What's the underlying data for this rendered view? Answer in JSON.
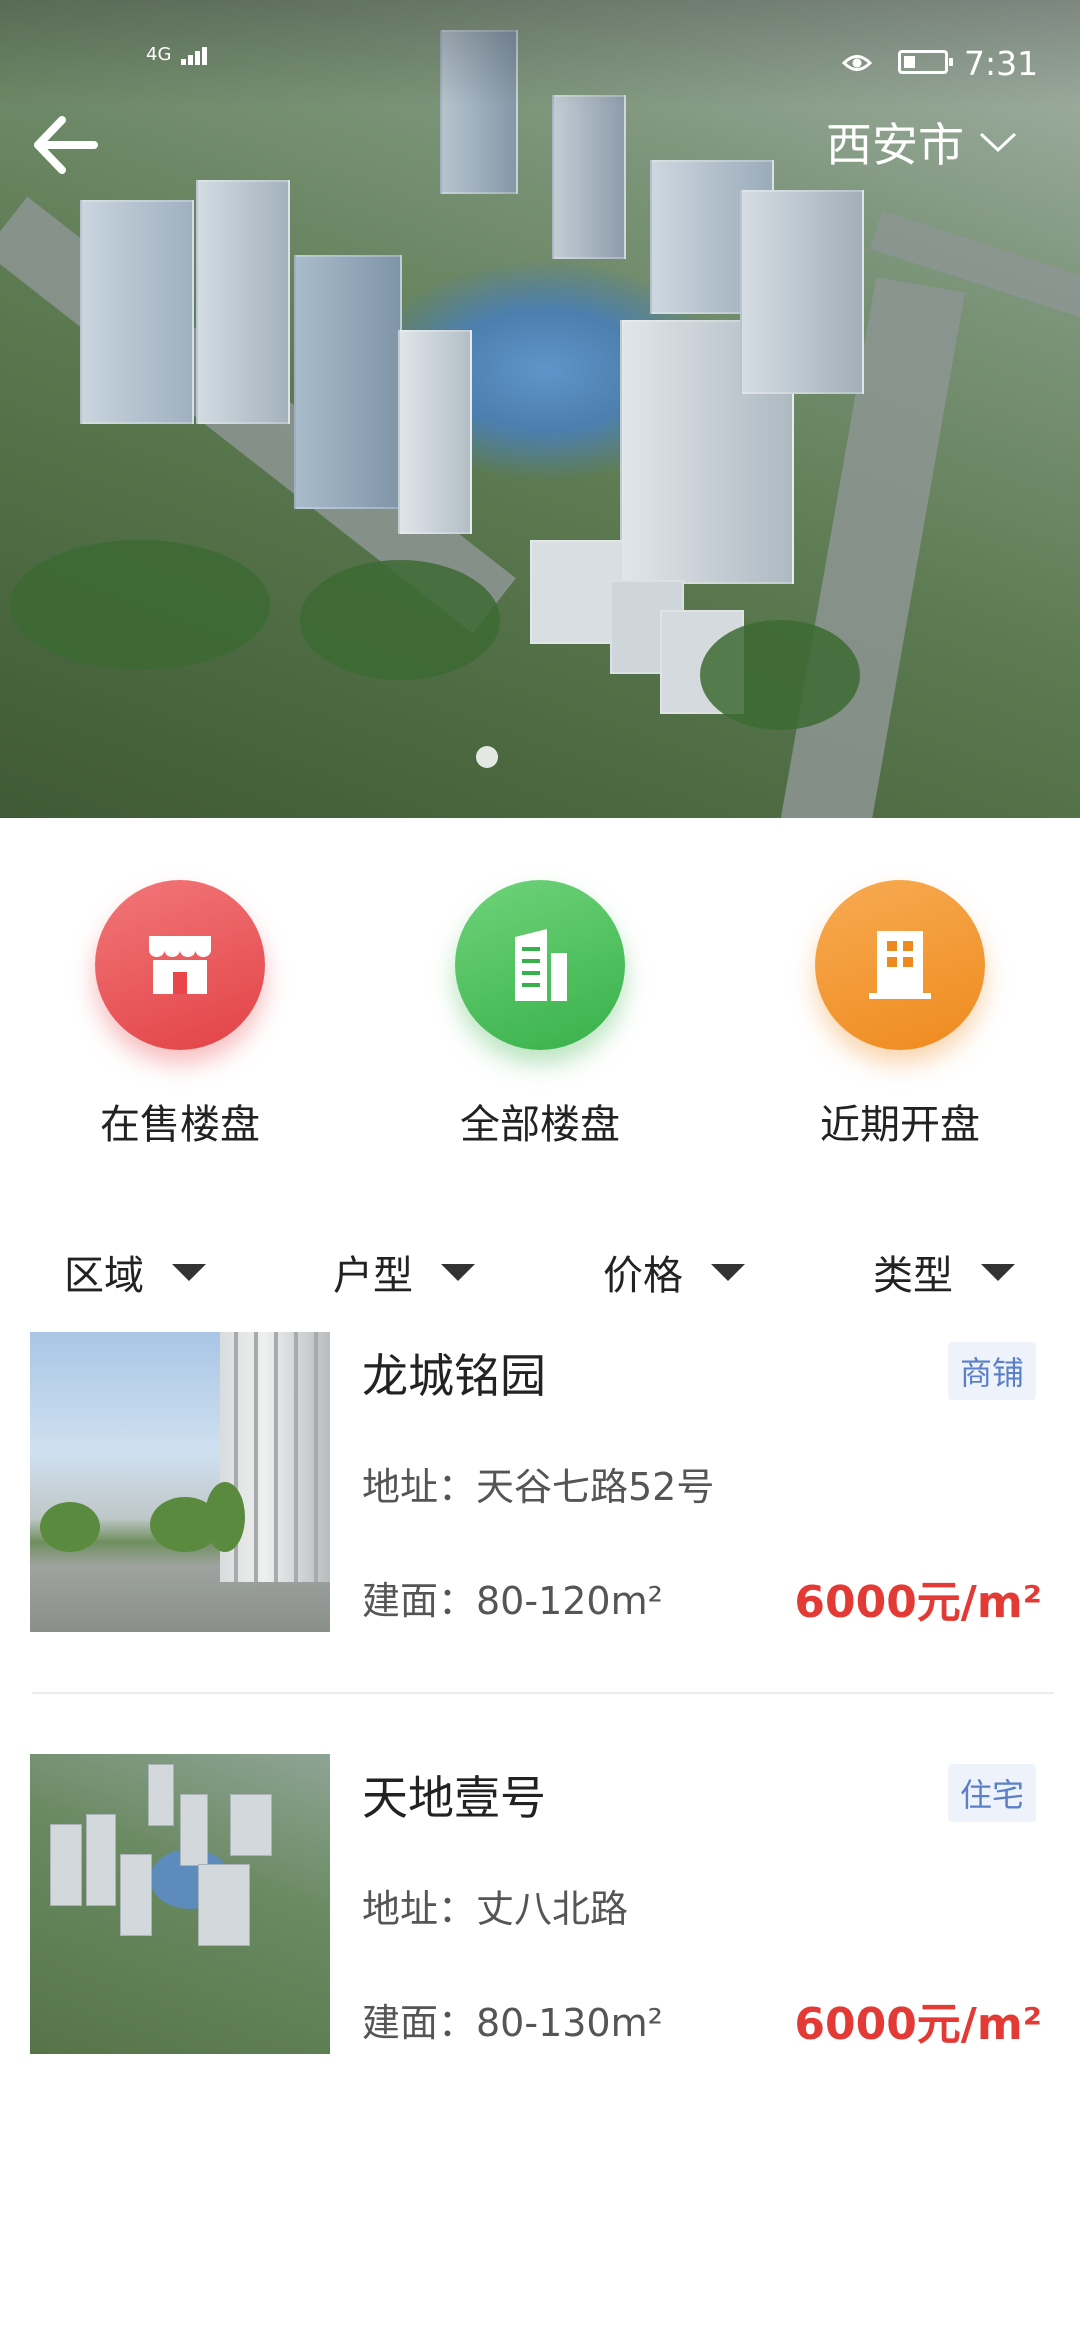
{
  "status_bar": {
    "network": "4G",
    "time": "7:31",
    "battery_level": 0.3
  },
  "header": {
    "city": "西安市"
  },
  "banner": {
    "dots": 1,
    "active_dot": 1
  },
  "categories": [
    {
      "label": "在售楼盘",
      "icon": "storefront-icon",
      "color": "#e8464a"
    },
    {
      "label": "全部楼盘",
      "icon": "building-icon",
      "color": "#38b14a"
    },
    {
      "label": "近期开盘",
      "icon": "office-icon",
      "color": "#ef8a1e"
    }
  ],
  "filters": [
    {
      "label": "区域"
    },
    {
      "label": "户型"
    },
    {
      "label": "价格"
    },
    {
      "label": "类型"
    }
  ],
  "listings": [
    {
      "name": "龙城铭园",
      "tag": "商铺",
      "address": "地址：天谷七路52号",
      "area": "建面：80-120m²",
      "price": "6000元/m²"
    },
    {
      "name": "天地壹号",
      "tag": "住宅",
      "address": "地址：丈八北路",
      "area": "建面：80-130m²",
      "price": "6000元/m²"
    }
  ],
  "colors": {
    "price": "#e43a36",
    "tag_text": "#5b80c8",
    "tag_bg": "#eef2fb"
  }
}
